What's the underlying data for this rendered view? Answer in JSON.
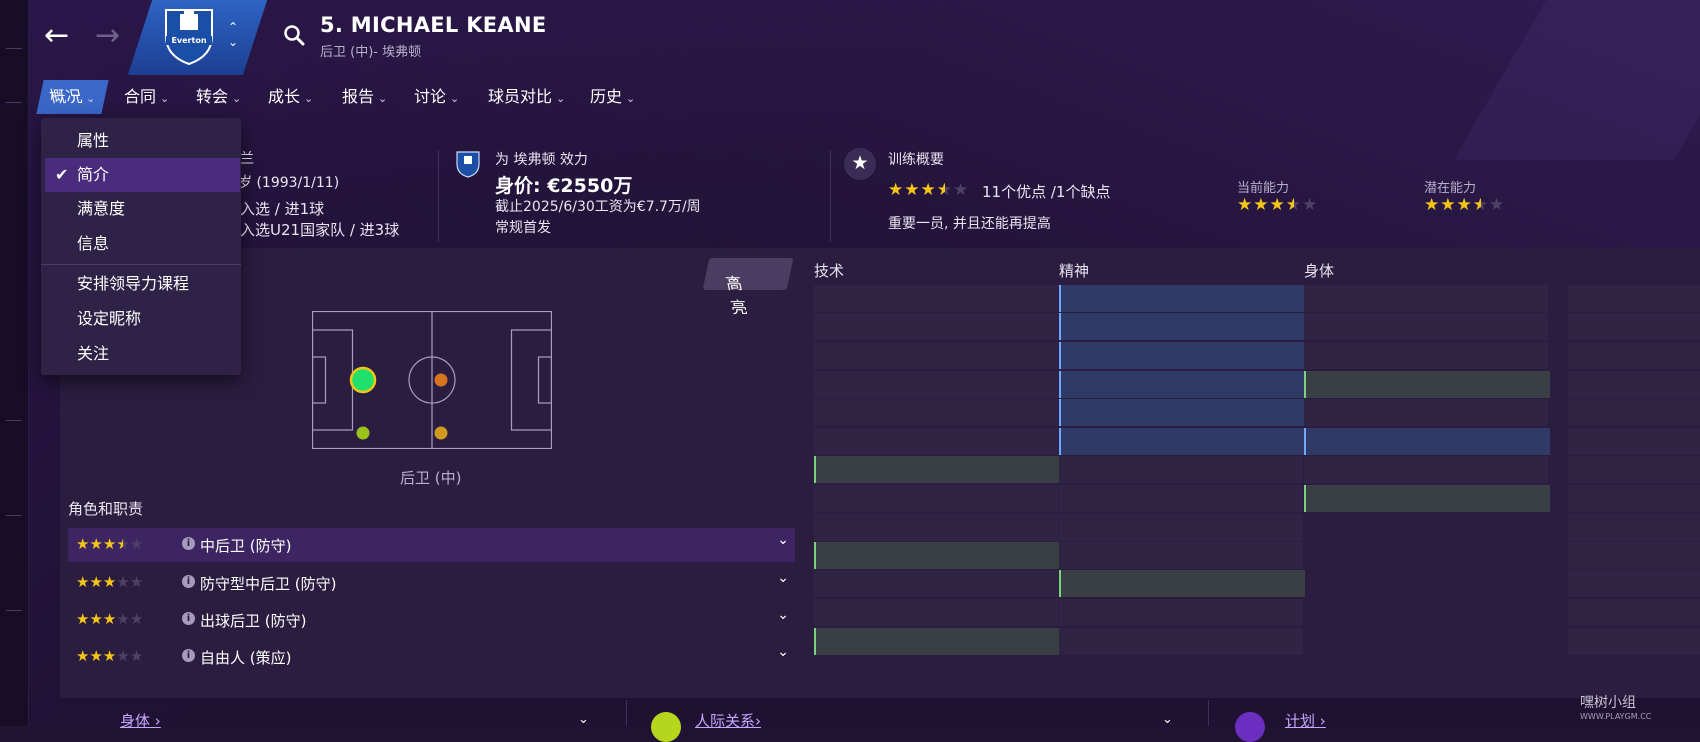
{
  "header": {
    "player_name": "5. MICHAEL KEANE",
    "player_sub": "后卫 (中)- 埃弗顿",
    "club_crest_text": "Everton"
  },
  "tabs": [
    {
      "label": "概况"
    },
    {
      "label": "合同"
    },
    {
      "label": "转会"
    },
    {
      "label": "成长"
    },
    {
      "label": "报告"
    },
    {
      "label": "讨论"
    },
    {
      "label": "球员对比"
    },
    {
      "label": "历史"
    }
  ],
  "dropdown": {
    "items": [
      "属性",
      "简介",
      "满意度",
      "信息",
      "安排领导力课程",
      "设定昵称",
      "关注"
    ],
    "selected": "简介"
  },
  "bio": {
    "nationality_tail": "兰",
    "dob_tail": "岁 (1993/1/11)",
    "caps_line1": "入选 / 进1球",
    "caps_line2": "入选U21国家队 / 进3球"
  },
  "club": {
    "plays_for": "为 埃弗顿 效力",
    "value": "身价: €2550万",
    "contract": "截止2025/6/30工资为€7.7万/周",
    "status": "常规首发"
  },
  "training": {
    "title": "训练概要",
    "rating_stars": 3.5,
    "strengths": "11个优点 /1个缺点",
    "summary": "重要一员, 并且还能再提高",
    "current_ability_label": "当前能力",
    "current_ability_stars": 3.5,
    "potential_ability_label": "潜在能力",
    "potential_ability_stars": 3.5
  },
  "panel": {
    "highlight_label": "高亮",
    "position_label": "后卫 (中)",
    "roles_title": "角色和职责",
    "roles": [
      {
        "name": "中后卫 (防守)",
        "stars": 3.5
      },
      {
        "name": "防守型中后卫 (防守)",
        "stars": 3
      },
      {
        "name": "出球后卫 (防守)",
        "stars": 3
      },
      {
        "name": "自由人 (策应)",
        "stars": 3
      }
    ]
  },
  "attributes": {
    "headers": [
      "技术",
      "精神",
      "身体"
    ]
  },
  "bottom": {
    "links": [
      "身体",
      "人际关系",
      "计划"
    ]
  },
  "watermark": {
    "text": "嘿树小组",
    "sub": "WWW.PLAYGM.CC"
  },
  "colors": {
    "accent": "#3a67c8",
    "star": "#f5c518",
    "highlight_blue": "#6ea8ff",
    "highlight_green": "#7bd37b"
  }
}
